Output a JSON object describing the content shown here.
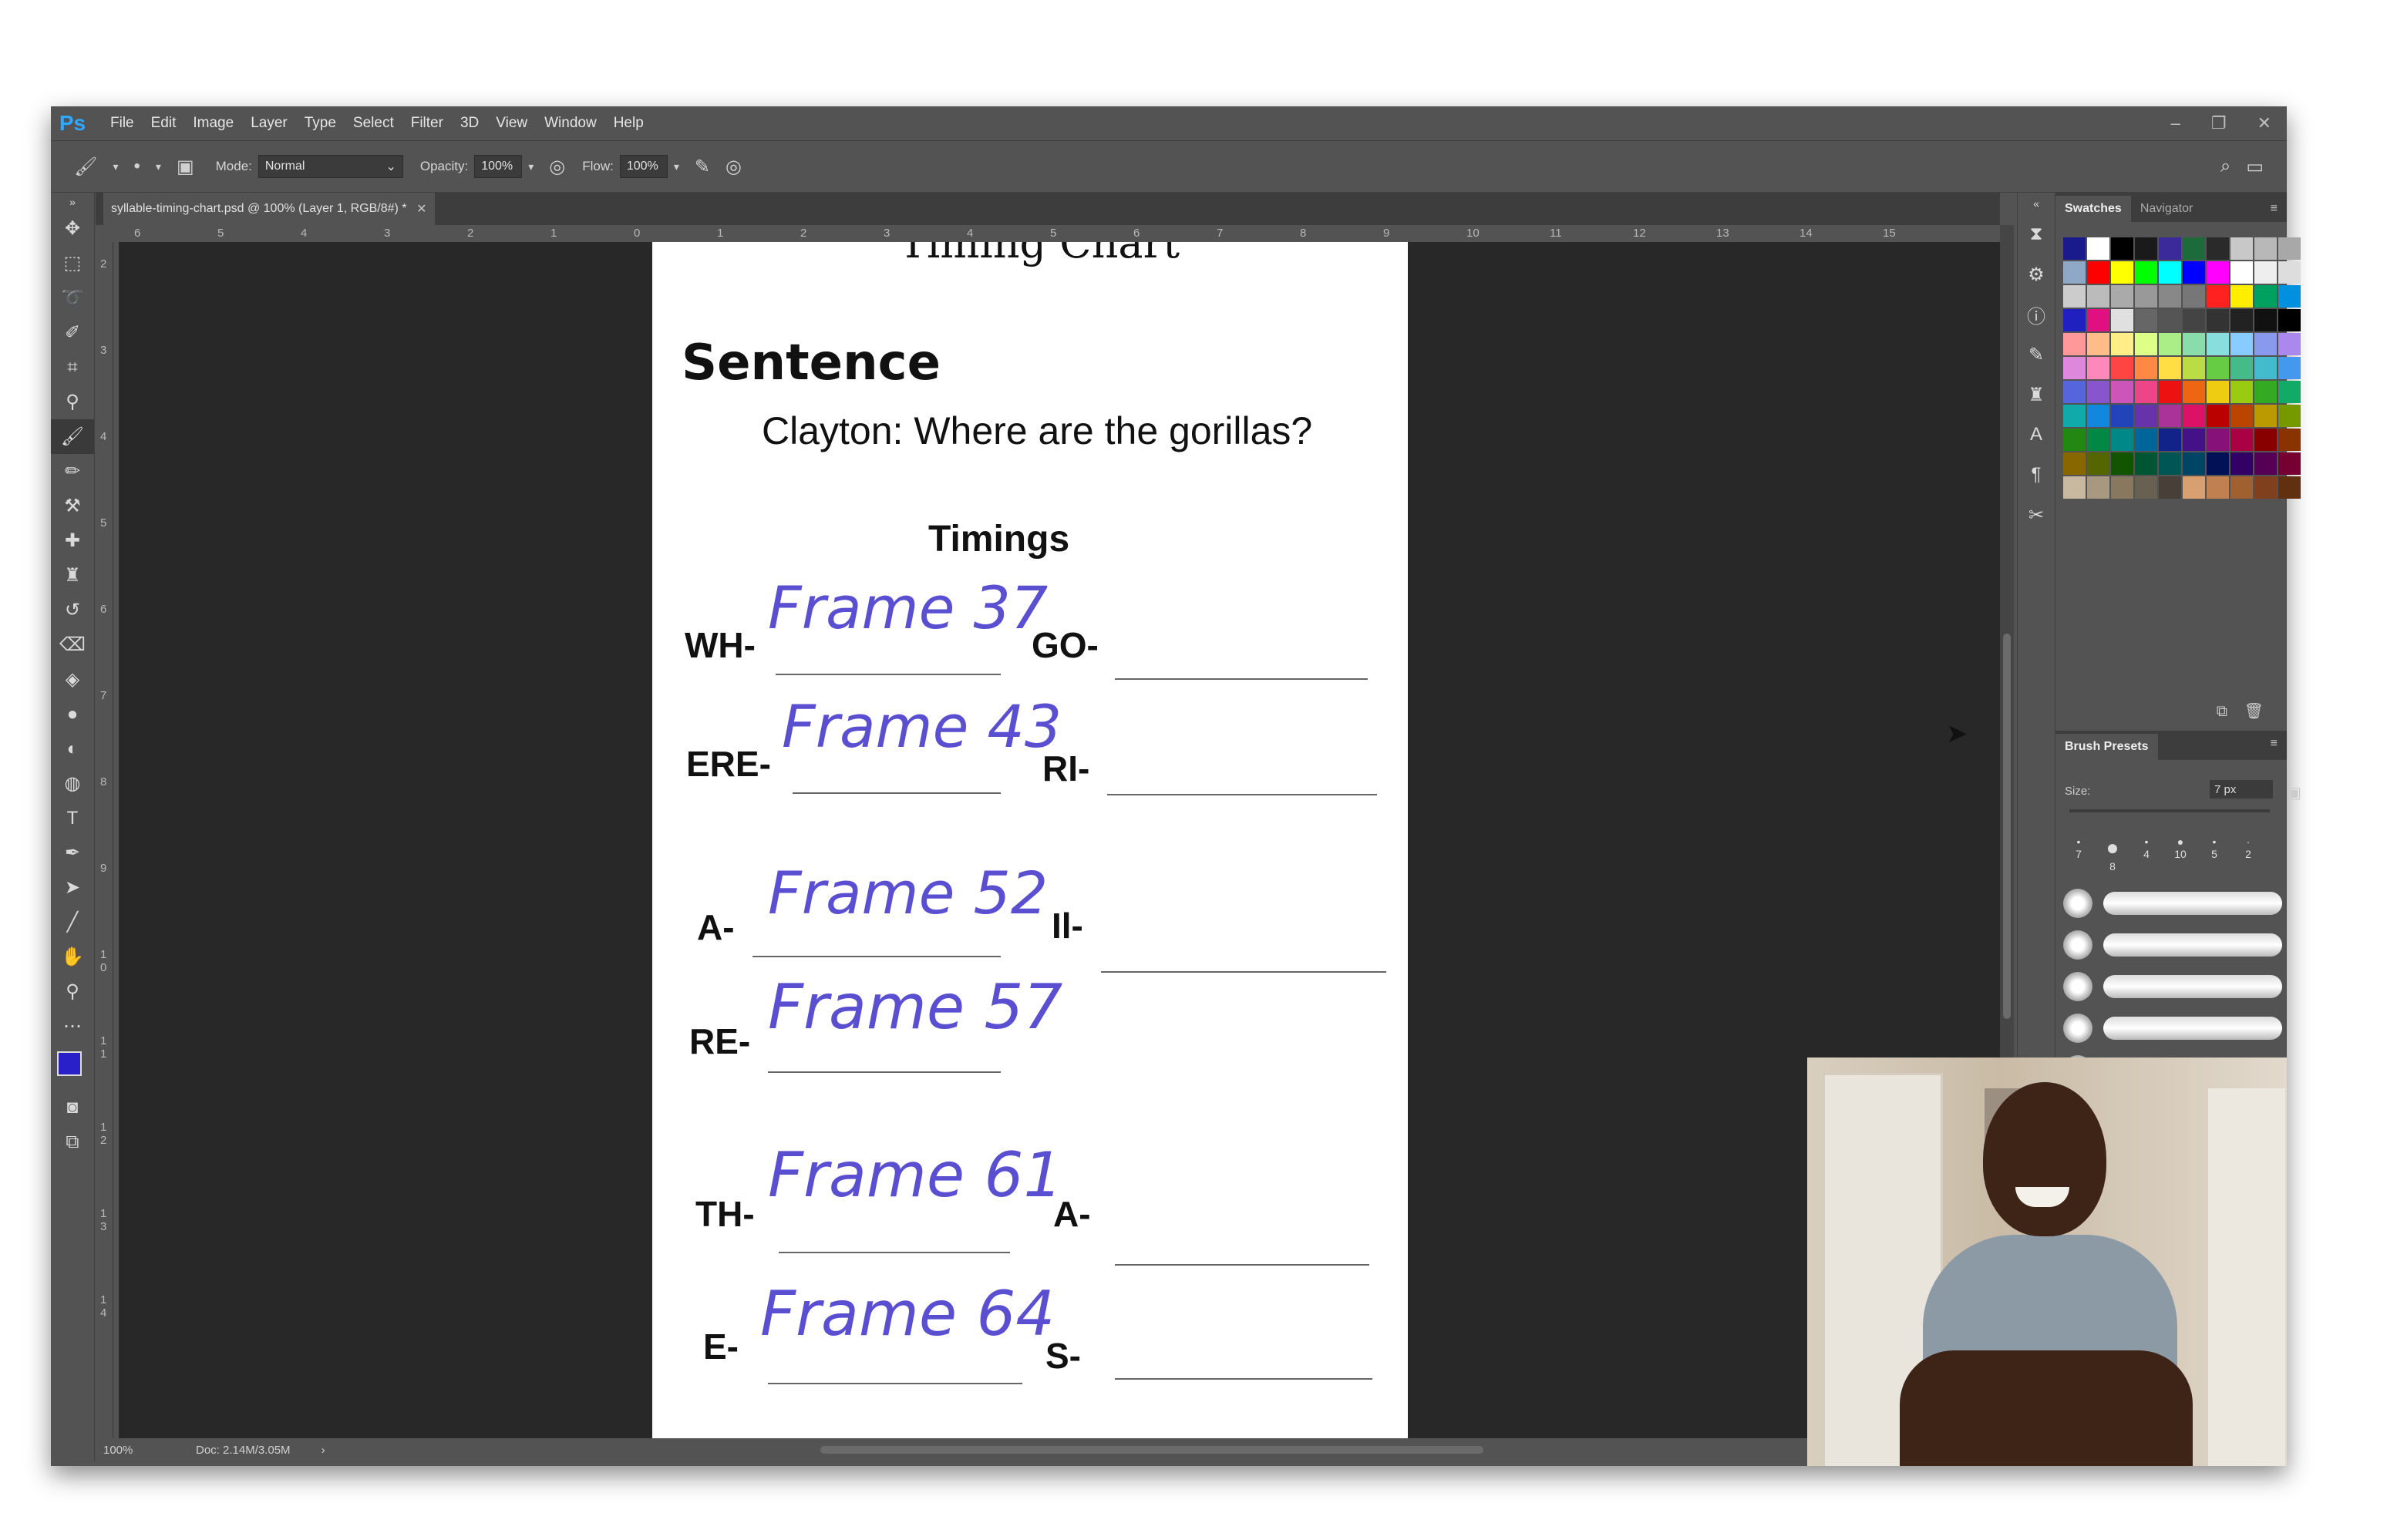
{
  "menubar": {
    "logo": "Ps",
    "items": [
      "File",
      "Edit",
      "Image",
      "Layer",
      "Type",
      "Select",
      "Filter",
      "3D",
      "View",
      "Window",
      "Help"
    ]
  },
  "options": {
    "mode_label": "Mode:",
    "mode_value": "Normal",
    "opacity_label": "Opacity:",
    "opacity_value": "100%",
    "flow_label": "Flow:",
    "flow_value": "100%"
  },
  "document": {
    "tab_title": "syllable-timing-chart.psd @ 100% (Layer 1, RGB/8#) *",
    "zoom": "100%",
    "doc_size": "Doc: 2.14M/3.05M"
  },
  "ruler": {
    "h_ticks": [
      "6",
      "5",
      "4",
      "3",
      "2",
      "1",
      "0",
      "1",
      "2",
      "3",
      "4",
      "5",
      "6",
      "7",
      "8",
      "9",
      "10",
      "11",
      "12",
      "13",
      "14",
      "15"
    ],
    "v_ticks": [
      "2",
      "3",
      "4",
      "5",
      "6",
      "7",
      "8",
      "9",
      "1 0",
      "1 1",
      "1 2",
      "1 3",
      "1 4"
    ]
  },
  "chart": {
    "title_partial": "Timing Chart",
    "heading": "Sentence",
    "sentence": "Clayton: Where are the gorillas?",
    "timings_heading": "Timings",
    "rows": [
      {
        "left": "WH-",
        "left_value": "Frame 37",
        "right": "GO-",
        "right_value": ""
      },
      {
        "left": "ERE-",
        "left_value": "Frame 43",
        "right": "RI-",
        "right_value": ""
      },
      {
        "left": "A-",
        "left_value": "Frame 52",
        "right": "Il-",
        "right_value": ""
      },
      {
        "left": "RE-",
        "left_value": "Frame 57",
        "right": "",
        "right_value": ""
      },
      {
        "left": "TH-",
        "left_value": "Frame 61",
        "right": "A-",
        "right_value": ""
      },
      {
        "left": "E-",
        "left_value": "Frame 64",
        "right": "S-",
        "right_value": ""
      }
    ]
  },
  "panels": {
    "swatches_tab": "Swatches",
    "navigator_tab": "Navigator",
    "brush_presets_tab": "Brush Presets",
    "size_label": "Size:",
    "size_value": "7 px",
    "tip_sizes": [
      "7",
      "8",
      "4",
      "10",
      "5",
      "2"
    ],
    "swatch_colors": [
      "#1a1a8c",
      "#ffffff",
      "#000000",
      "#1a1a1a",
      "#3a2a9a",
      "#1d6b3a",
      "#2a2a2a",
      "#c8c8c8",
      "#b8b8b8",
      "#a8a8a8",
      "#8fa8c8",
      "#ff0000",
      "#ffff00",
      "#00ff00",
      "#00ffff",
      "#0000ff",
      "#ff00ff",
      "#ffffff",
      "#eeeeee",
      "#dddddd",
      "#cccccc",
      "#bbbbbb",
      "#aaaaaa",
      "#999999",
      "#888888",
      "#777777",
      "#ff2020",
      "#ffee00",
      "#00a060",
      "#0090e0",
      "#2020c0",
      "#e01080",
      "#e0e0e0",
      "#666666",
      "#555555",
      "#444444",
      "#333333",
      "#222222",
      "#111111",
      "#000000",
      "#ff9999",
      "#ffbb88",
      "#ffee88",
      "#ddff88",
      "#aaee88",
      "#88ddaa",
      "#88dddd",
      "#88ccff",
      "#8899ee",
      "#aa88ee",
      "#dd88dd",
      "#ff88bb",
      "#ff4444",
      "#ff8844",
      "#ffdd44",
      "#bbdd44",
      "#66cc44",
      "#44bb88",
      "#44bbcc",
      "#4499ee",
      "#5566dd",
      "#8855cc",
      "#cc55bb",
      "#ee4488",
      "#ee1111",
      "#ee6611",
      "#eecc11",
      "#99cc11",
      "#33aa22",
      "#11aa66",
      "#11aaaa",
      "#1188dd",
      "#2244bb",
      "#6633aa",
      "#aa3399",
      "#dd1166",
      "#bb0000",
      "#bb4400",
      "#bb9900",
      "#779900",
      "#228811",
      "#008844",
      "#008888",
      "#006699",
      "#112288",
      "#441188",
      "#881177",
      "#aa0044",
      "#880000",
      "#883300",
      "#886600",
      "#556600",
      "#115500",
      "#005533",
      "#005555",
      "#004466",
      "#001155",
      "#330066",
      "#550055",
      "#770033",
      "#c8b8a0",
      "#a89880",
      "#887860",
      "#686050",
      "#484038",
      "#d8a070",
      "#c08050",
      "#a06030",
      "#804020",
      "#603010"
    ]
  },
  "status_icons": [
    "brush-tool-icon",
    "brush-size-icon",
    "brush-settings-icon",
    "pressure-opacity-icon",
    "airbrush-icon",
    "pressure-size-icon",
    "search-icon",
    "workspace-icon"
  ]
}
